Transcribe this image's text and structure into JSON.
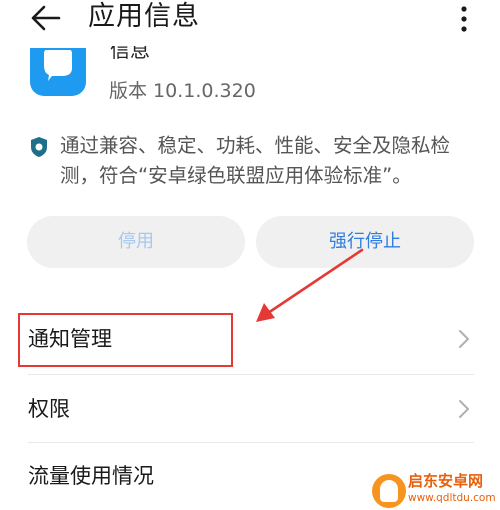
{
  "header": {
    "title": "应用信息",
    "back_icon": "arrow-left-icon",
    "more_icon": "more-vertical-icon"
  },
  "app": {
    "name": "信息",
    "version": "版本 10.1.0.320",
    "icon": "message-bubble-icon",
    "icon_color": "#1e9bf0"
  },
  "certification": {
    "icon": "shield-check-icon",
    "text": "通过兼容、稳定、功耗、性能、安全及隐私检测，符合“安卓绿色联盟应用体验标准”。"
  },
  "buttons": {
    "disable_label": "停用",
    "force_stop_label": "强行停止"
  },
  "settings_list": [
    {
      "label": "通知管理",
      "icon": "chevron-right-icon"
    },
    {
      "label": "权限",
      "icon": "chevron-right-icon"
    },
    {
      "label": "流量使用情况"
    }
  ],
  "annotation": {
    "color": "#e53935"
  },
  "watermark": {
    "brand": "启东安卓网",
    "url": "www.qdltdu.com"
  },
  "colors": {
    "accent": "#2f7de1",
    "disabled_text": "#a8c7ef",
    "button_bg": "#f0f0f0"
  }
}
